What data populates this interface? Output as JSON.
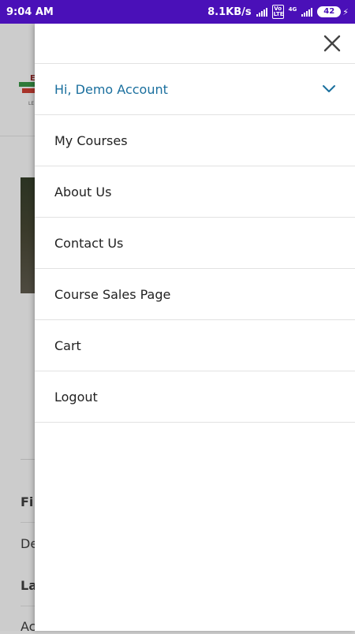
{
  "status_bar": {
    "time": "9:04 AM",
    "speed": "8.1KB/s",
    "volte": "Vo LTE",
    "network": "4G",
    "battery": "42",
    "bar_color": "#4a10b8"
  },
  "background_page": {
    "logo_letter": "E",
    "logo_small_text": "LE",
    "field_1_label": "Fi",
    "field_1_value": "De",
    "field_2_label": "La",
    "field_2_value": "Ac"
  },
  "drawer": {
    "close_icon": "close-icon",
    "account_label": "Hi, Demo Account",
    "accent_color": "#1a6f9e",
    "items": [
      {
        "label": "My Courses"
      },
      {
        "label": "About Us"
      },
      {
        "label": "Contact Us"
      },
      {
        "label": "Course Sales Page"
      },
      {
        "label": "Cart"
      },
      {
        "label": "Logout"
      }
    ]
  }
}
